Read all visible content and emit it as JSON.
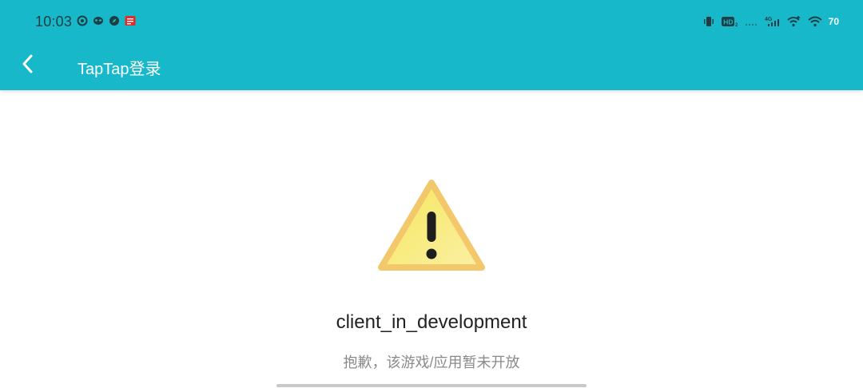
{
  "status_bar": {
    "time": "10:03",
    "battery": "70",
    "notification_icons": [
      "weibo-icon",
      "mask-icon",
      "compass-icon",
      "news-app-icon"
    ],
    "system_icons": [
      "vibrate-icon",
      "hd-icon",
      "signal-icon",
      "4g-signal-icon",
      "wifi-calling-icon",
      "wifi-icon"
    ]
  },
  "toolbar": {
    "title": "TapTap登录",
    "back_icon": "chevron-left-icon"
  },
  "main": {
    "icon": "warning-icon",
    "message": "client_in_development",
    "subtitle": "抱歉，该游戏/应用暂未开放"
  },
  "colors": {
    "appbar": "#16b8c9",
    "warning_fill": "#f7e27a",
    "warning_border": "#f2c86b"
  }
}
